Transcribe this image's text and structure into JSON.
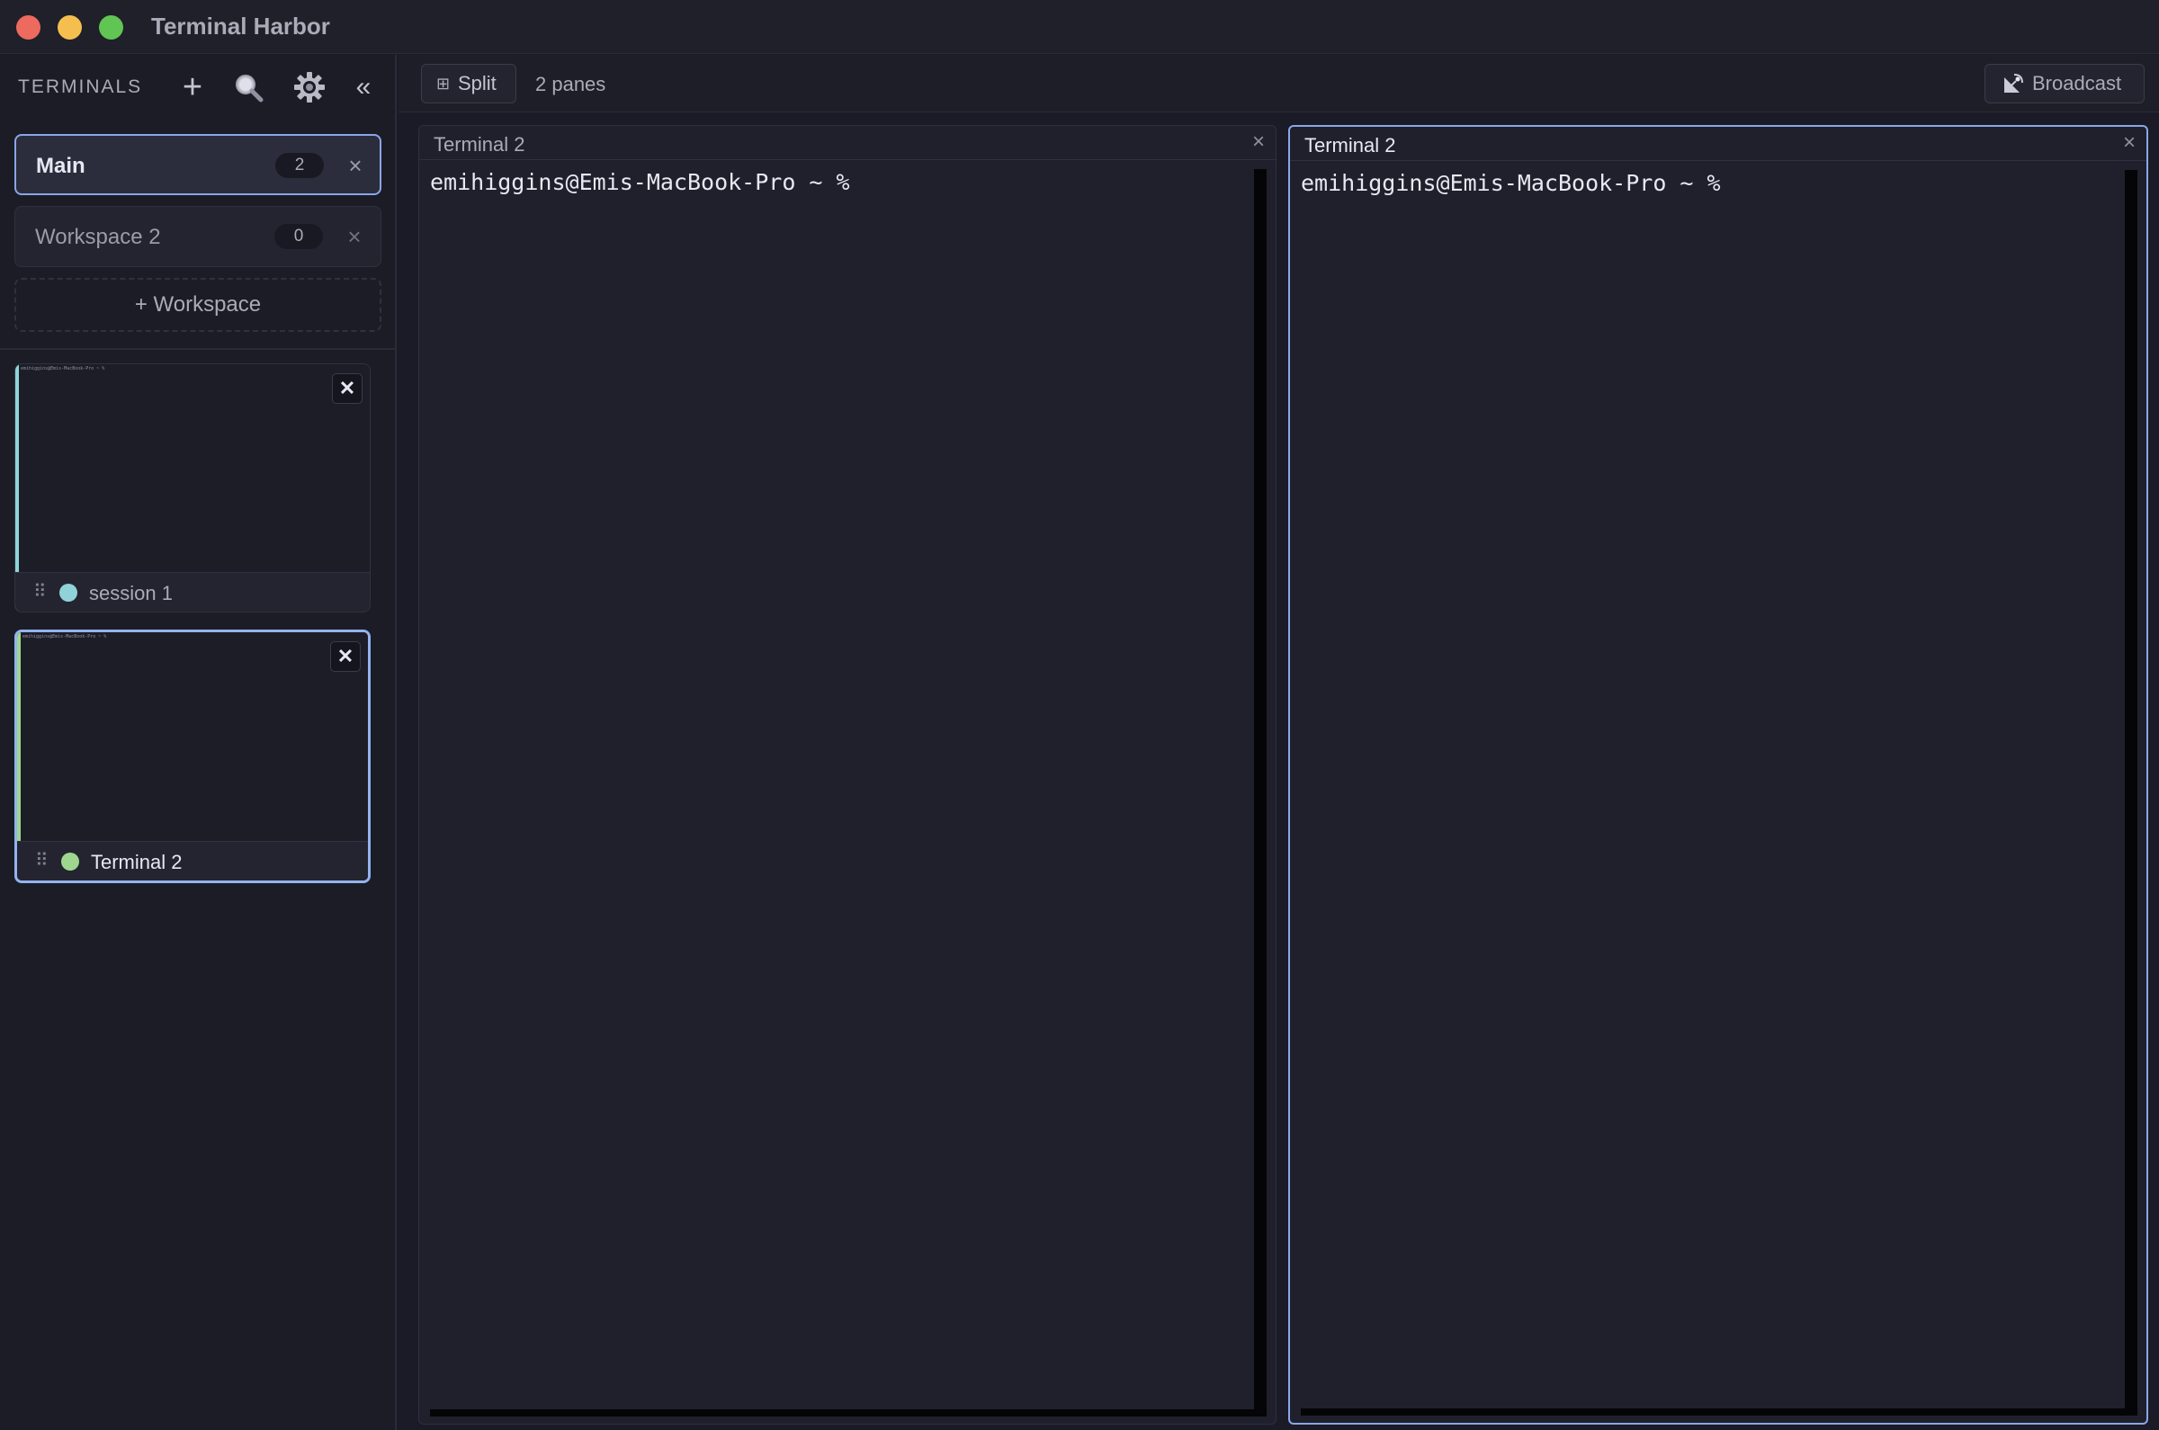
{
  "app": {
    "title": "Terminal Harbor",
    "colors": {
      "accent": "#8aa6e8",
      "close": "#ed6a5e",
      "minimize": "#f5bf4f",
      "maximize": "#61c554"
    }
  },
  "sidebar": {
    "title": "TERMINALS",
    "add_icon": "plus-icon",
    "search_icon": "search-icon",
    "settings_icon": "gear-icon",
    "collapse_label": "«",
    "workspaces": [
      {
        "name": "Main",
        "count": "2",
        "active": true
      },
      {
        "name": "Workspace 2",
        "count": "0",
        "active": false
      }
    ],
    "add_workspace_label": "+ Workspace",
    "terminals": [
      {
        "name": "session 1",
        "dot_color": "#8fd3d9",
        "preview_text": "emihiggins@Emis-MacBook-Pro ~ %",
        "selected": false
      },
      {
        "name": "Terminal 2",
        "dot_color": "#9fd68f",
        "preview_text": "emihiggins@Emis-MacBook-Pro ~ %",
        "selected": true
      }
    ]
  },
  "toolbar": {
    "split_icon": "grid-icon",
    "split_label": "Split",
    "pane_count": "2 panes",
    "broadcast_icon": "satellite-icon",
    "broadcast_label": "Broadcast"
  },
  "panes": [
    {
      "title": "Terminal 2",
      "prompt": "emihiggins@Emis-MacBook-Pro ~ %",
      "focused": false
    },
    {
      "title": "Terminal 2",
      "prompt": "emihiggins@Emis-MacBook-Pro ~ %",
      "focused": true
    }
  ]
}
